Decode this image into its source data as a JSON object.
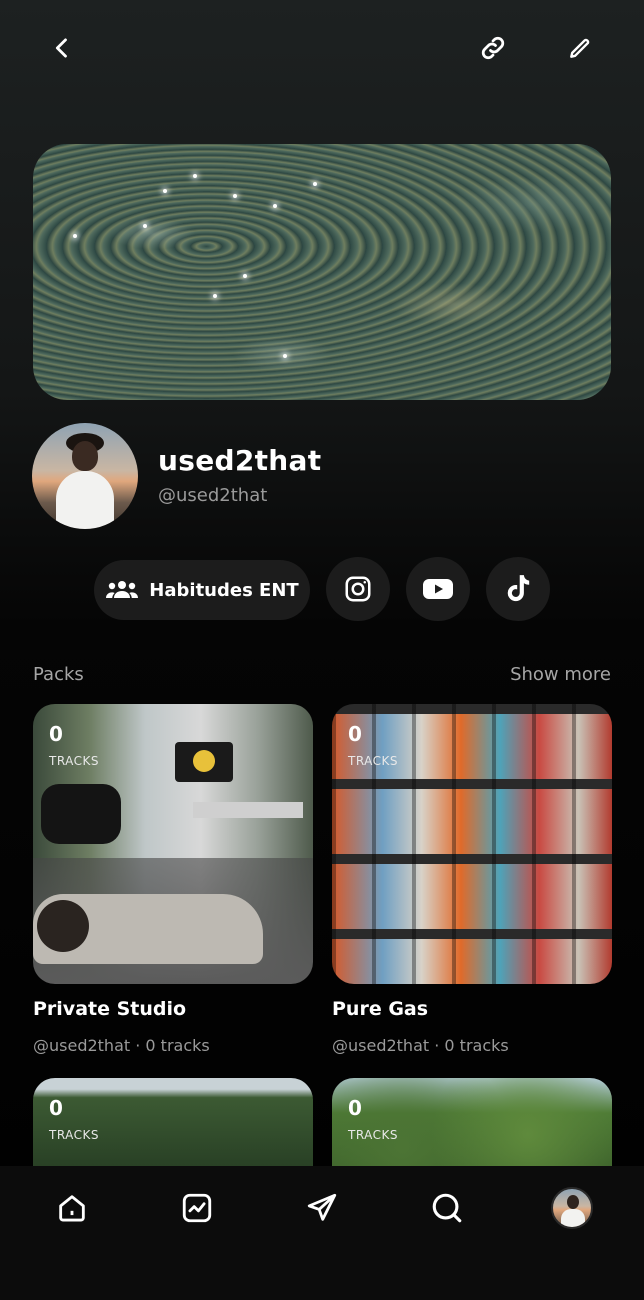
{
  "profile": {
    "display_name": "used2that",
    "handle": "@used2that"
  },
  "links": {
    "group_label": "Habitudes ENT",
    "socials": [
      "instagram-icon",
      "youtube-icon",
      "tiktok-icon"
    ]
  },
  "packs_section": {
    "title": "Packs",
    "show_more": "Show more"
  },
  "packs": [
    {
      "count": "0",
      "count_label": "TRACKS",
      "title": "Private Studio",
      "subtitle": "@used2that · 0 tracks"
    },
    {
      "count": "0",
      "count_label": "TRACKS",
      "title": "Pure Gas",
      "subtitle": "@used2that · 0 tracks"
    },
    {
      "count": "0",
      "count_label": "TRACKS"
    },
    {
      "count": "0",
      "count_label": "TRACKS"
    }
  ],
  "nav": [
    "home-icon",
    "activity-icon",
    "send-icon",
    "search-icon",
    "profile-avatar"
  ],
  "colors": {
    "background": "#000000",
    "pill": "#1c1c1c",
    "muted_text": "#9a9a9a"
  }
}
